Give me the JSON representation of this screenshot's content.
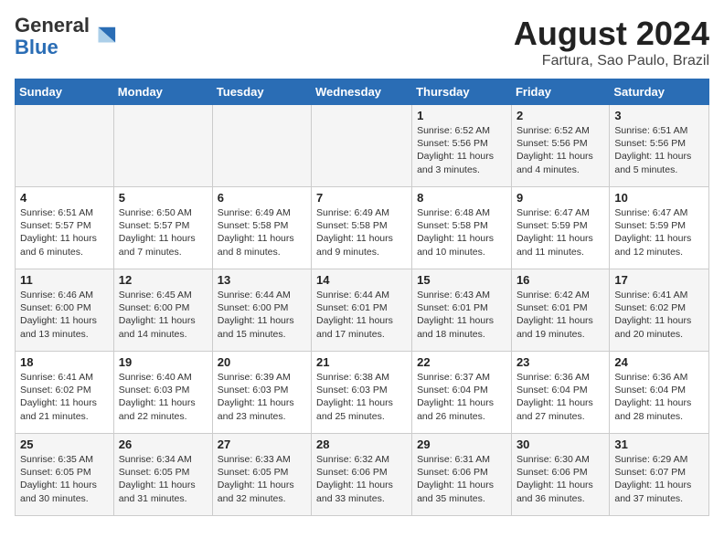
{
  "logo": {
    "general": "General",
    "blue": "Blue"
  },
  "title": "August 2024",
  "subtitle": "Fartura, Sao Paulo, Brazil",
  "days_of_week": [
    "Sunday",
    "Monday",
    "Tuesday",
    "Wednesday",
    "Thursday",
    "Friday",
    "Saturday"
  ],
  "weeks": [
    [
      {
        "day": "",
        "info": ""
      },
      {
        "day": "",
        "info": ""
      },
      {
        "day": "",
        "info": ""
      },
      {
        "day": "",
        "info": ""
      },
      {
        "day": "1",
        "info": "Sunrise: 6:52 AM\nSunset: 5:56 PM\nDaylight: 11 hours and 3 minutes."
      },
      {
        "day": "2",
        "info": "Sunrise: 6:52 AM\nSunset: 5:56 PM\nDaylight: 11 hours and 4 minutes."
      },
      {
        "day": "3",
        "info": "Sunrise: 6:51 AM\nSunset: 5:56 PM\nDaylight: 11 hours and 5 minutes."
      }
    ],
    [
      {
        "day": "4",
        "info": "Sunrise: 6:51 AM\nSunset: 5:57 PM\nDaylight: 11 hours and 6 minutes."
      },
      {
        "day": "5",
        "info": "Sunrise: 6:50 AM\nSunset: 5:57 PM\nDaylight: 11 hours and 7 minutes."
      },
      {
        "day": "6",
        "info": "Sunrise: 6:49 AM\nSunset: 5:58 PM\nDaylight: 11 hours and 8 minutes."
      },
      {
        "day": "7",
        "info": "Sunrise: 6:49 AM\nSunset: 5:58 PM\nDaylight: 11 hours and 9 minutes."
      },
      {
        "day": "8",
        "info": "Sunrise: 6:48 AM\nSunset: 5:58 PM\nDaylight: 11 hours and 10 minutes."
      },
      {
        "day": "9",
        "info": "Sunrise: 6:47 AM\nSunset: 5:59 PM\nDaylight: 11 hours and 11 minutes."
      },
      {
        "day": "10",
        "info": "Sunrise: 6:47 AM\nSunset: 5:59 PM\nDaylight: 11 hours and 12 minutes."
      }
    ],
    [
      {
        "day": "11",
        "info": "Sunrise: 6:46 AM\nSunset: 6:00 PM\nDaylight: 11 hours and 13 minutes."
      },
      {
        "day": "12",
        "info": "Sunrise: 6:45 AM\nSunset: 6:00 PM\nDaylight: 11 hours and 14 minutes."
      },
      {
        "day": "13",
        "info": "Sunrise: 6:44 AM\nSunset: 6:00 PM\nDaylight: 11 hours and 15 minutes."
      },
      {
        "day": "14",
        "info": "Sunrise: 6:44 AM\nSunset: 6:01 PM\nDaylight: 11 hours and 17 minutes."
      },
      {
        "day": "15",
        "info": "Sunrise: 6:43 AM\nSunset: 6:01 PM\nDaylight: 11 hours and 18 minutes."
      },
      {
        "day": "16",
        "info": "Sunrise: 6:42 AM\nSunset: 6:01 PM\nDaylight: 11 hours and 19 minutes."
      },
      {
        "day": "17",
        "info": "Sunrise: 6:41 AM\nSunset: 6:02 PM\nDaylight: 11 hours and 20 minutes."
      }
    ],
    [
      {
        "day": "18",
        "info": "Sunrise: 6:41 AM\nSunset: 6:02 PM\nDaylight: 11 hours and 21 minutes."
      },
      {
        "day": "19",
        "info": "Sunrise: 6:40 AM\nSunset: 6:03 PM\nDaylight: 11 hours and 22 minutes."
      },
      {
        "day": "20",
        "info": "Sunrise: 6:39 AM\nSunset: 6:03 PM\nDaylight: 11 hours and 23 minutes."
      },
      {
        "day": "21",
        "info": "Sunrise: 6:38 AM\nSunset: 6:03 PM\nDaylight: 11 hours and 25 minutes."
      },
      {
        "day": "22",
        "info": "Sunrise: 6:37 AM\nSunset: 6:04 PM\nDaylight: 11 hours and 26 minutes."
      },
      {
        "day": "23",
        "info": "Sunrise: 6:36 AM\nSunset: 6:04 PM\nDaylight: 11 hours and 27 minutes."
      },
      {
        "day": "24",
        "info": "Sunrise: 6:36 AM\nSunset: 6:04 PM\nDaylight: 11 hours and 28 minutes."
      }
    ],
    [
      {
        "day": "25",
        "info": "Sunrise: 6:35 AM\nSunset: 6:05 PM\nDaylight: 11 hours and 30 minutes."
      },
      {
        "day": "26",
        "info": "Sunrise: 6:34 AM\nSunset: 6:05 PM\nDaylight: 11 hours and 31 minutes."
      },
      {
        "day": "27",
        "info": "Sunrise: 6:33 AM\nSunset: 6:05 PM\nDaylight: 11 hours and 32 minutes."
      },
      {
        "day": "28",
        "info": "Sunrise: 6:32 AM\nSunset: 6:06 PM\nDaylight: 11 hours and 33 minutes."
      },
      {
        "day": "29",
        "info": "Sunrise: 6:31 AM\nSunset: 6:06 PM\nDaylight: 11 hours and 35 minutes."
      },
      {
        "day": "30",
        "info": "Sunrise: 6:30 AM\nSunset: 6:06 PM\nDaylight: 11 hours and 36 minutes."
      },
      {
        "day": "31",
        "info": "Sunrise: 6:29 AM\nSunset: 6:07 PM\nDaylight: 11 hours and 37 minutes."
      }
    ]
  ]
}
